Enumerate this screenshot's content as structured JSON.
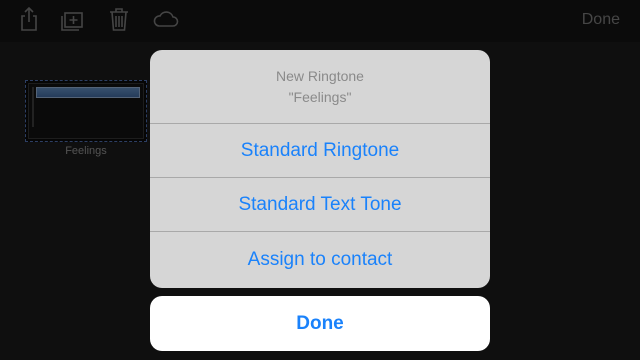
{
  "toolbar": {
    "icons": [
      "share-icon",
      "add-icon",
      "trash-icon",
      "cloud-icon"
    ],
    "done_label": "Done"
  },
  "project": {
    "name": "Feelings"
  },
  "action_sheet": {
    "title": "New Ringtone",
    "subtitle": "\"Feelings\"",
    "options": [
      "Standard Ringtone",
      "Standard Text Tone",
      "Assign to contact"
    ],
    "cancel_label": "Done"
  },
  "colors": {
    "accent": "#1a82fb",
    "sheet_bg": "#d6d6d6",
    "toolbar_text": "#8d8d8d"
  }
}
